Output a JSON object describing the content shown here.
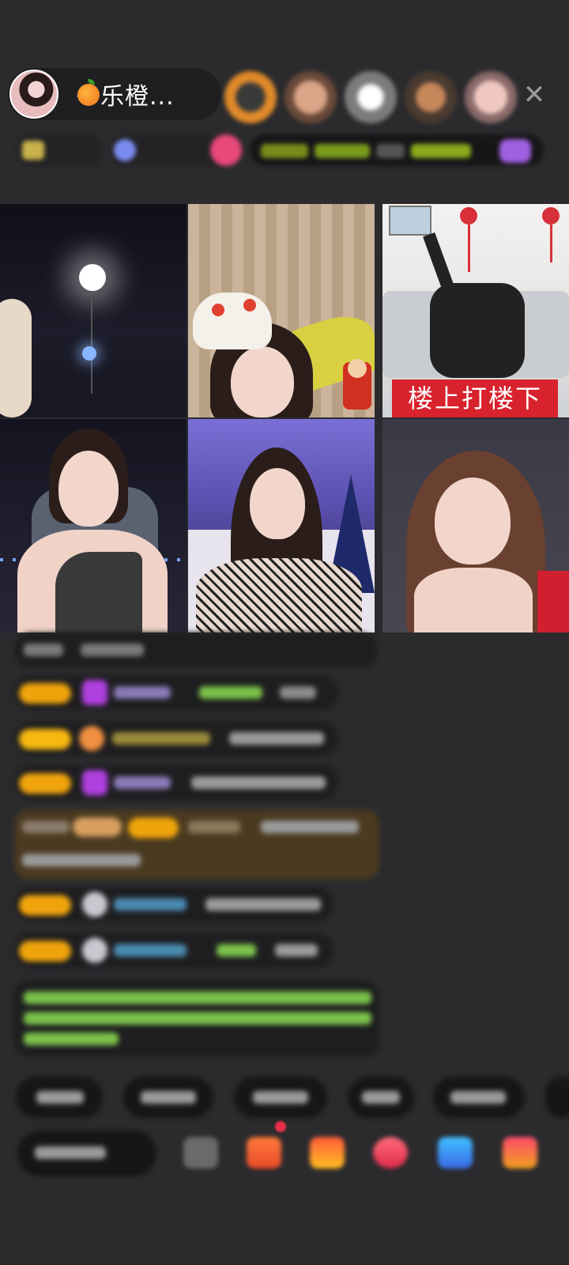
{
  "header": {
    "host_name": "～乐橙...",
    "host_emoji_icon": "orange-icon",
    "close_icon": "close-icon",
    "close_glyph": "✕",
    "viewer_count": 5
  },
  "grid": {
    "tiles": 6,
    "tile3_banner": "楼上打楼下"
  },
  "chat": {
    "message_count": 9,
    "accent_level_color": "#f0a40c",
    "accent_green": "#7bc24a"
  },
  "bottom_bar": {
    "quick_reply_count": 6,
    "tool_icons": [
      "menu-icon",
      "gift-box-icon",
      "red-packet-icon",
      "chat-bubble-icon",
      "game-icon",
      "gift-icon"
    ]
  }
}
